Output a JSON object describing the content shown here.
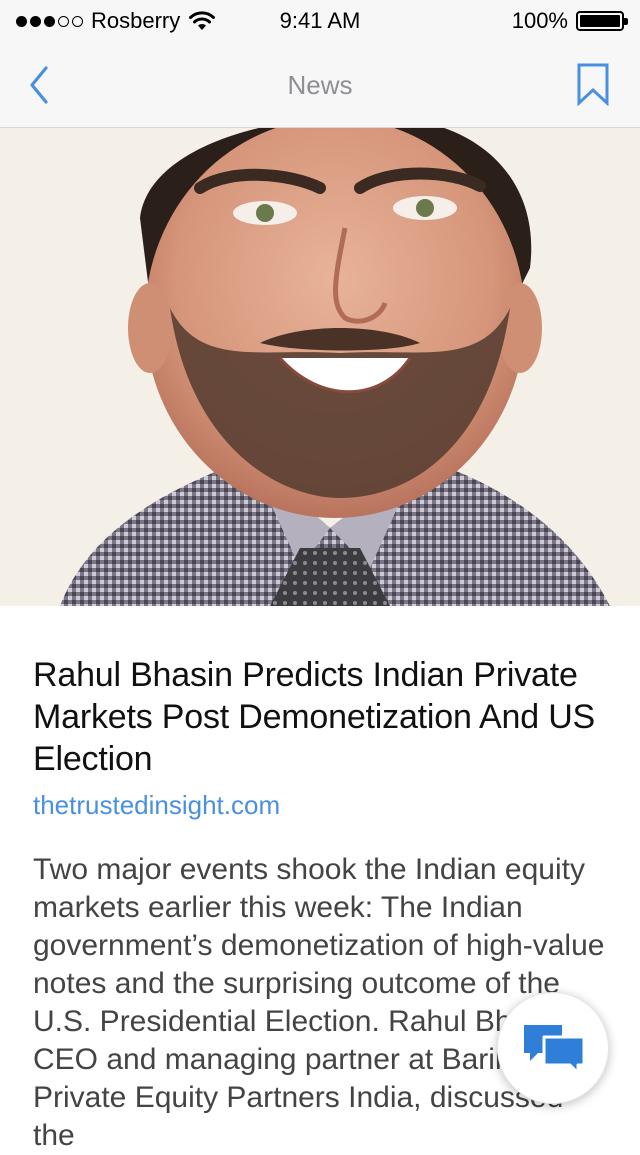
{
  "status_bar": {
    "carrier": "Rosberry",
    "time": "9:41 AM",
    "battery": "100%",
    "signal_icon": "signal-dots-icon",
    "wifi_icon": "wifi-icon",
    "battery_icon": "battery-icon"
  },
  "nav": {
    "title": "News",
    "back_icon": "chevron-left-icon",
    "bookmark_icon": "bookmark-icon"
  },
  "article": {
    "image": "portrait-photo",
    "headline": "Rahul Bhasin Predicts Indian Private Markets Post Demonetization And US Election",
    "source": "thetrustedinsight.com",
    "body": "Two major events shook the Indian equity markets earlier this week: The Indian government’s demonetization of high-value notes and the surprising outcome of the U.S. Presidential Election. Rahul Bhasin, CEO and managing partner at Baring Private Equity Partners India, discussed the"
  },
  "fab": {
    "icon": "chat-bubbles-icon"
  },
  "colors": {
    "accent": "#4a90e2",
    "bar_background": "#f7f7f7",
    "title_gray": "#8e8e93",
    "body_gray": "#444444"
  }
}
